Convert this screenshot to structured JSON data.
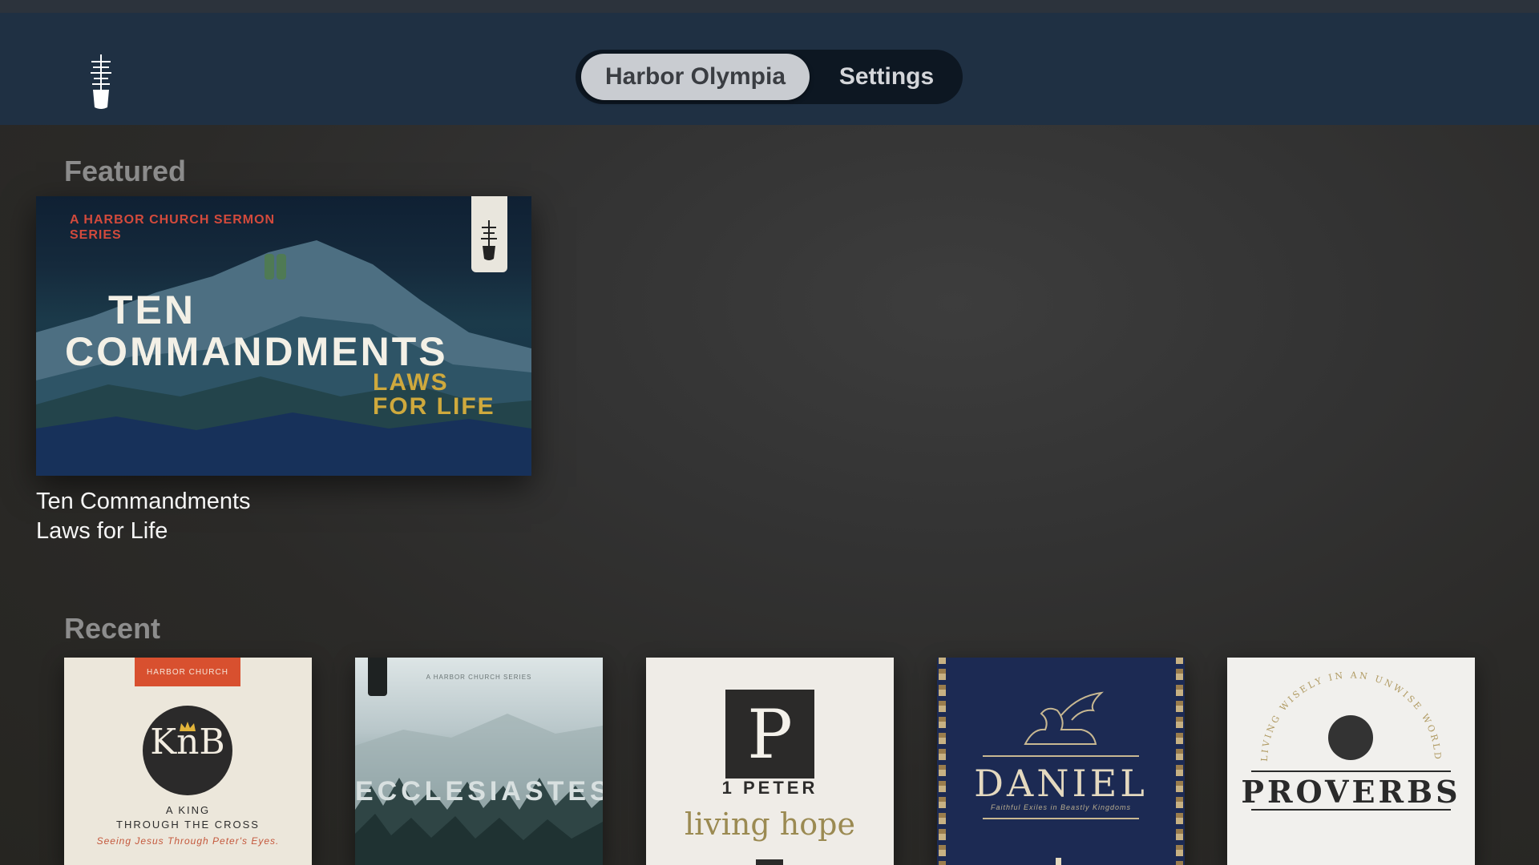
{
  "nav": {
    "tabs": [
      {
        "label": "Harbor Olympia",
        "active": true
      },
      {
        "label": "Settings",
        "active": false
      }
    ],
    "logo_icon": "ship-mast-icon"
  },
  "featured": {
    "section_title": "Featured",
    "item": {
      "art_kicker": "A HARBOR CHURCH SERMON SERIES",
      "art_title_line1": "TEN",
      "art_title_line2": "COMMANDMENTS",
      "art_subtitle_line1": "LAWS",
      "art_subtitle_line2": "FOR LIFE",
      "caption_line1": "Ten Commandments",
      "caption_line2": "Laws for Life"
    }
  },
  "recent": {
    "section_title": "Recent",
    "items": [
      {
        "band": "HARBOR CHURCH",
        "monogram": "KnB",
        "line1": "A KING",
        "line2": "THROUGH THE CROSS",
        "line3": "Seeing Jesus Through Peter's Eyes."
      },
      {
        "kicker": "A HARBOR CHURCH SERIES",
        "title": "ECCLESIASTES"
      },
      {
        "glyph": "P",
        "title": "1 PETER",
        "subtitle": "living hope"
      },
      {
        "title": "DANIEL",
        "tagline": "Faithful Exiles in Beastly Kingdoms"
      },
      {
        "arc_text": "LIVING WISELY IN AN UNWISE WORLD",
        "title": "PROVERBS"
      }
    ]
  },
  "colors": {
    "topbar": "#1f3043",
    "segment_bg": "#0d1722",
    "segment_active": "#c9ccd1",
    "section_title": "#8d8d8d",
    "accent_red": "#d34a3c",
    "accent_gold": "#cfa93d"
  }
}
